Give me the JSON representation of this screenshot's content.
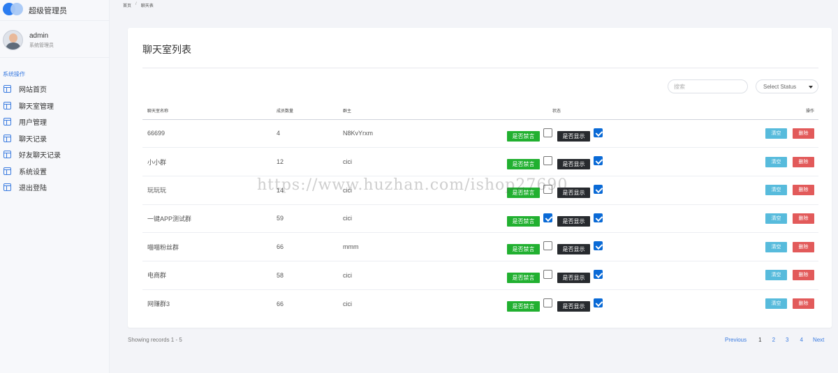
{
  "brand": {
    "title": "超级管理员"
  },
  "user": {
    "name": "admin",
    "role": "系统管理员"
  },
  "sidebar": {
    "section_label": "系统操作",
    "items": [
      {
        "label": "网站首页",
        "icon": "table-icon"
      },
      {
        "label": "聊天室管理",
        "icon": "table-icon"
      },
      {
        "label": "用户管理",
        "icon": "table-icon"
      },
      {
        "label": "聊天记录",
        "icon": "table-icon"
      },
      {
        "label": "好友聊天记录",
        "icon": "table-icon"
      },
      {
        "label": "系统设置",
        "icon": "table-icon"
      },
      {
        "label": "退出登陆",
        "icon": "table-icon"
      }
    ]
  },
  "breadcrumb": {
    "home": "首页",
    "separator": "/",
    "current": "聊天表"
  },
  "page": {
    "title": "聊天室列表"
  },
  "filters": {
    "search_placeholder": "搜索",
    "status_select": "Select Status"
  },
  "table": {
    "headers": {
      "name": "聊天室名称",
      "count": "成员数量",
      "owner": "群主",
      "status": "状态",
      "action": "操作"
    },
    "buttons": {
      "ban": "是否禁言",
      "show": "是否显示",
      "clear": "清空",
      "delete": "删除"
    },
    "rows": [
      {
        "name": "66699",
        "count": "4",
        "owner": "N8KvYrxm",
        "ban_checked": false,
        "show_checked": true
      },
      {
        "name": "小小群",
        "count": "12",
        "owner": "cici",
        "ban_checked": false,
        "show_checked": true
      },
      {
        "name": "玩玩玩",
        "count": "14",
        "owner": "cici",
        "ban_checked": false,
        "show_checked": true
      },
      {
        "name": "一键APP测试群",
        "count": "59",
        "owner": "cici",
        "ban_checked": true,
        "show_checked": true
      },
      {
        "name": "喵喵粉丝群",
        "count": "66",
        "owner": "mmm",
        "ban_checked": false,
        "show_checked": true
      },
      {
        "name": "电商群",
        "count": "58",
        "owner": "cici",
        "ban_checked": false,
        "show_checked": true
      },
      {
        "name": "网赚群3",
        "count": "66",
        "owner": "cici",
        "ban_checked": false,
        "show_checked": true
      }
    ]
  },
  "footer": {
    "records": "Showing records 1 - 5"
  },
  "pagination": {
    "previous": "Previous",
    "pages": [
      "1",
      "2",
      "3",
      "4"
    ],
    "next": "Next"
  },
  "watermark": "https://www.huzhan.com/ishop27690",
  "colors": {
    "accent": "#3a7be0",
    "ban_button": "#21b030",
    "show_button": "#272a2e",
    "clear_button": "#57bbdc",
    "delete_button": "#e25a5a"
  }
}
